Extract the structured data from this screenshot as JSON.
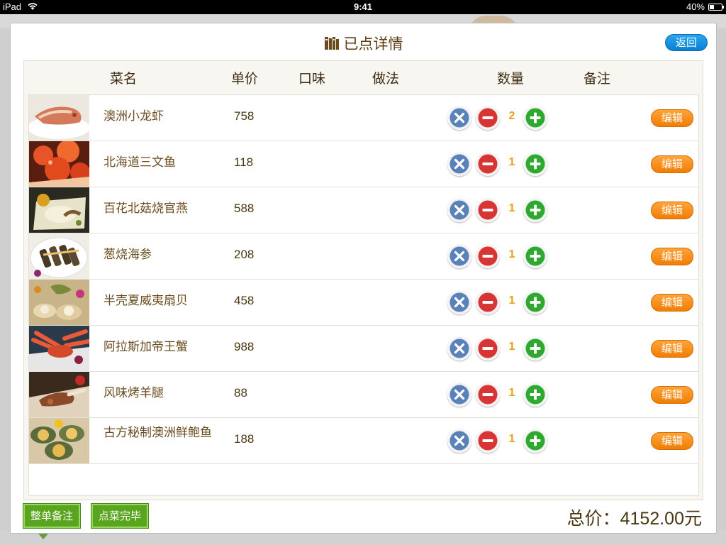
{
  "status_bar": {
    "carrier": "iPad",
    "time": "9:41",
    "battery": "40%",
    "battery_level": 0.4
  },
  "modal": {
    "title": "已点详情",
    "back_label": "返回"
  },
  "table": {
    "columns": {
      "name": "菜名",
      "price": "单价",
      "flavor": "口味",
      "method": "做法",
      "quantity": "数量",
      "note": "备注"
    },
    "rows": [
      {
        "name": "澳洲小龙虾",
        "price": "758",
        "quantity": "2",
        "edit_label": "编辑",
        "thumb": "lobster"
      },
      {
        "name": "北海道三文鱼",
        "price": "118",
        "quantity": "1",
        "edit_label": "编辑",
        "thumb": "salmon"
      },
      {
        "name": "百花北菇烧官燕",
        "price": "588",
        "quantity": "1",
        "edit_label": "编辑",
        "thumb": "birdnest"
      },
      {
        "name": "葱烧海参",
        "price": "208",
        "quantity": "1",
        "edit_label": "编辑",
        "thumb": "sea-cucumber"
      },
      {
        "name": "半壳夏威夷扇贝",
        "price": "458",
        "quantity": "1",
        "edit_label": "编辑",
        "thumb": "scallop"
      },
      {
        "name": "阿拉斯加帝王蟹",
        "price": "988",
        "quantity": "1",
        "edit_label": "编辑",
        "thumb": "king-crab"
      },
      {
        "name": "风味烤羊腿",
        "price": "88",
        "quantity": "1",
        "edit_label": "编辑",
        "thumb": "lamb-leg"
      },
      {
        "name": "古方秘制澳洲鲜鲍鱼",
        "price": "188",
        "quantity": "1",
        "edit_label": "编辑",
        "thumb": "abalone"
      }
    ]
  },
  "footer": {
    "order_note_label": "整单备注",
    "finish_label": "点菜完毕",
    "total_label": "总价：",
    "total_value": "4152.00元"
  },
  "colors": {
    "title_brown": "#5a3d14",
    "back_blue": "#1a93e0",
    "edit_orange": "#f08a14",
    "qty_gold": "#e2a318",
    "footer_green": "#5aa51f",
    "delete_blue": "#5a82b8",
    "minus_red": "#d83434",
    "plus_green": "#2ea82e"
  }
}
